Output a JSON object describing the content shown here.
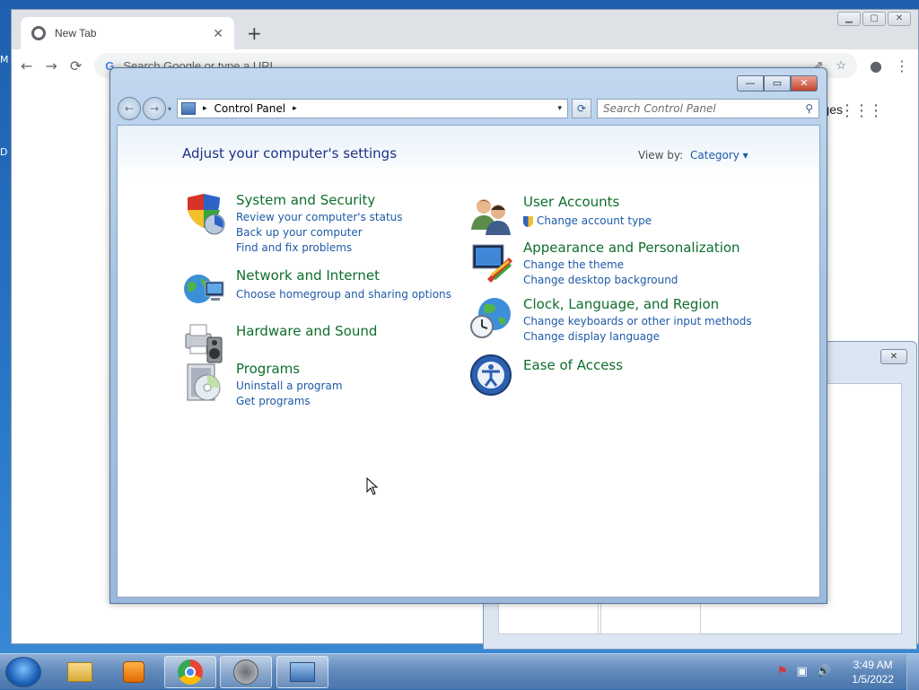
{
  "desktop": {
    "edge_label_1": "M",
    "edge_label_2": "D"
  },
  "chrome": {
    "tab_title": "New Tab",
    "tab_close": "✕",
    "new_tab": "+",
    "omnibox_placeholder": "Search Google or type a URL",
    "google_g": "G",
    "images_link": "ges",
    "win_min": "▁",
    "win_max": "▢",
    "win_close": "✕",
    "nav": {
      "back": "←",
      "forward": "→",
      "reload": "⟳"
    },
    "toolbar_icons": {
      "share": "⇗",
      "star": "☆",
      "profile": "●",
      "menu": "⋮"
    },
    "apps": "⋮⋮⋮"
  },
  "background_dialog": {
    "close": "✕"
  },
  "control_panel": {
    "caption": {
      "min": "—",
      "max": "▭",
      "close": "✕"
    },
    "nav": {
      "back": "←",
      "forward": "→",
      "dropdown": "▾"
    },
    "breadcrumb": [
      "Control Panel"
    ],
    "breadcrumb_sep": "▸",
    "refresh": "⟳",
    "search_placeholder": "Search Control Panel",
    "search_icon": "⚲",
    "heading": "Adjust your computer's settings",
    "view_by_label": "View by:",
    "view_by_value": "Category ▾",
    "categories_left": [
      {
        "title": "System and Security",
        "links": [
          "Review your computer's status",
          "Back up your computer",
          "Find and fix problems"
        ],
        "icon": "shield-icon"
      },
      {
        "title": "Network and Internet",
        "links": [
          "Choose homegroup and sharing options"
        ],
        "icon": "network-globe-icon"
      },
      {
        "title": "Hardware and Sound",
        "links": [],
        "icon": "printer-speaker-icon"
      },
      {
        "title": "Programs",
        "links": [
          "Uninstall a program",
          "Get programs"
        ],
        "icon": "programs-disc-icon"
      }
    ],
    "categories_right": [
      {
        "title": "User Accounts",
        "links": [
          "Change account type"
        ],
        "icon": "users-icon"
      },
      {
        "title": "Appearance and Personalization",
        "links": [
          "Change the theme",
          "Change desktop background"
        ],
        "icon": "monitor-paint-icon"
      },
      {
        "title": "Clock, Language, and Region",
        "links": [
          "Change keyboards or other input methods",
          "Change display language"
        ],
        "icon": "globe-clock-icon"
      },
      {
        "title": "Ease of Access",
        "links": [],
        "icon": "ease-of-access-icon"
      }
    ]
  },
  "taskbar": {
    "clock_time": "3:49 AM",
    "clock_date": "1/5/2022",
    "tray": {
      "flag": "⚑",
      "network": "▣",
      "volume": "🔊"
    }
  }
}
